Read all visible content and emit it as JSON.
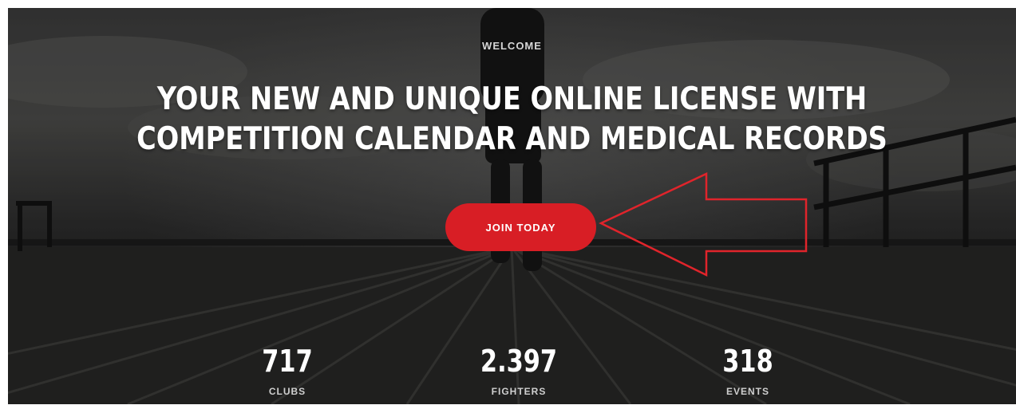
{
  "hero": {
    "eyebrow": "WELCOME",
    "headline_line1": "YOUR NEW AND UNIQUE ONLINE LICENSE WITH",
    "headline_line2": "COMPETITION CALENDAR AND MEDICAL RECORDS",
    "cta_label": "JOIN TODAY",
    "cta_color": "#d81e25",
    "annotation": "red-outline-arrow"
  },
  "stats": [
    {
      "value": "717",
      "label": "CLUBS"
    },
    {
      "value": "2.397",
      "label": "FIGHTERS"
    },
    {
      "value": "318",
      "label": "EVENTS"
    }
  ]
}
